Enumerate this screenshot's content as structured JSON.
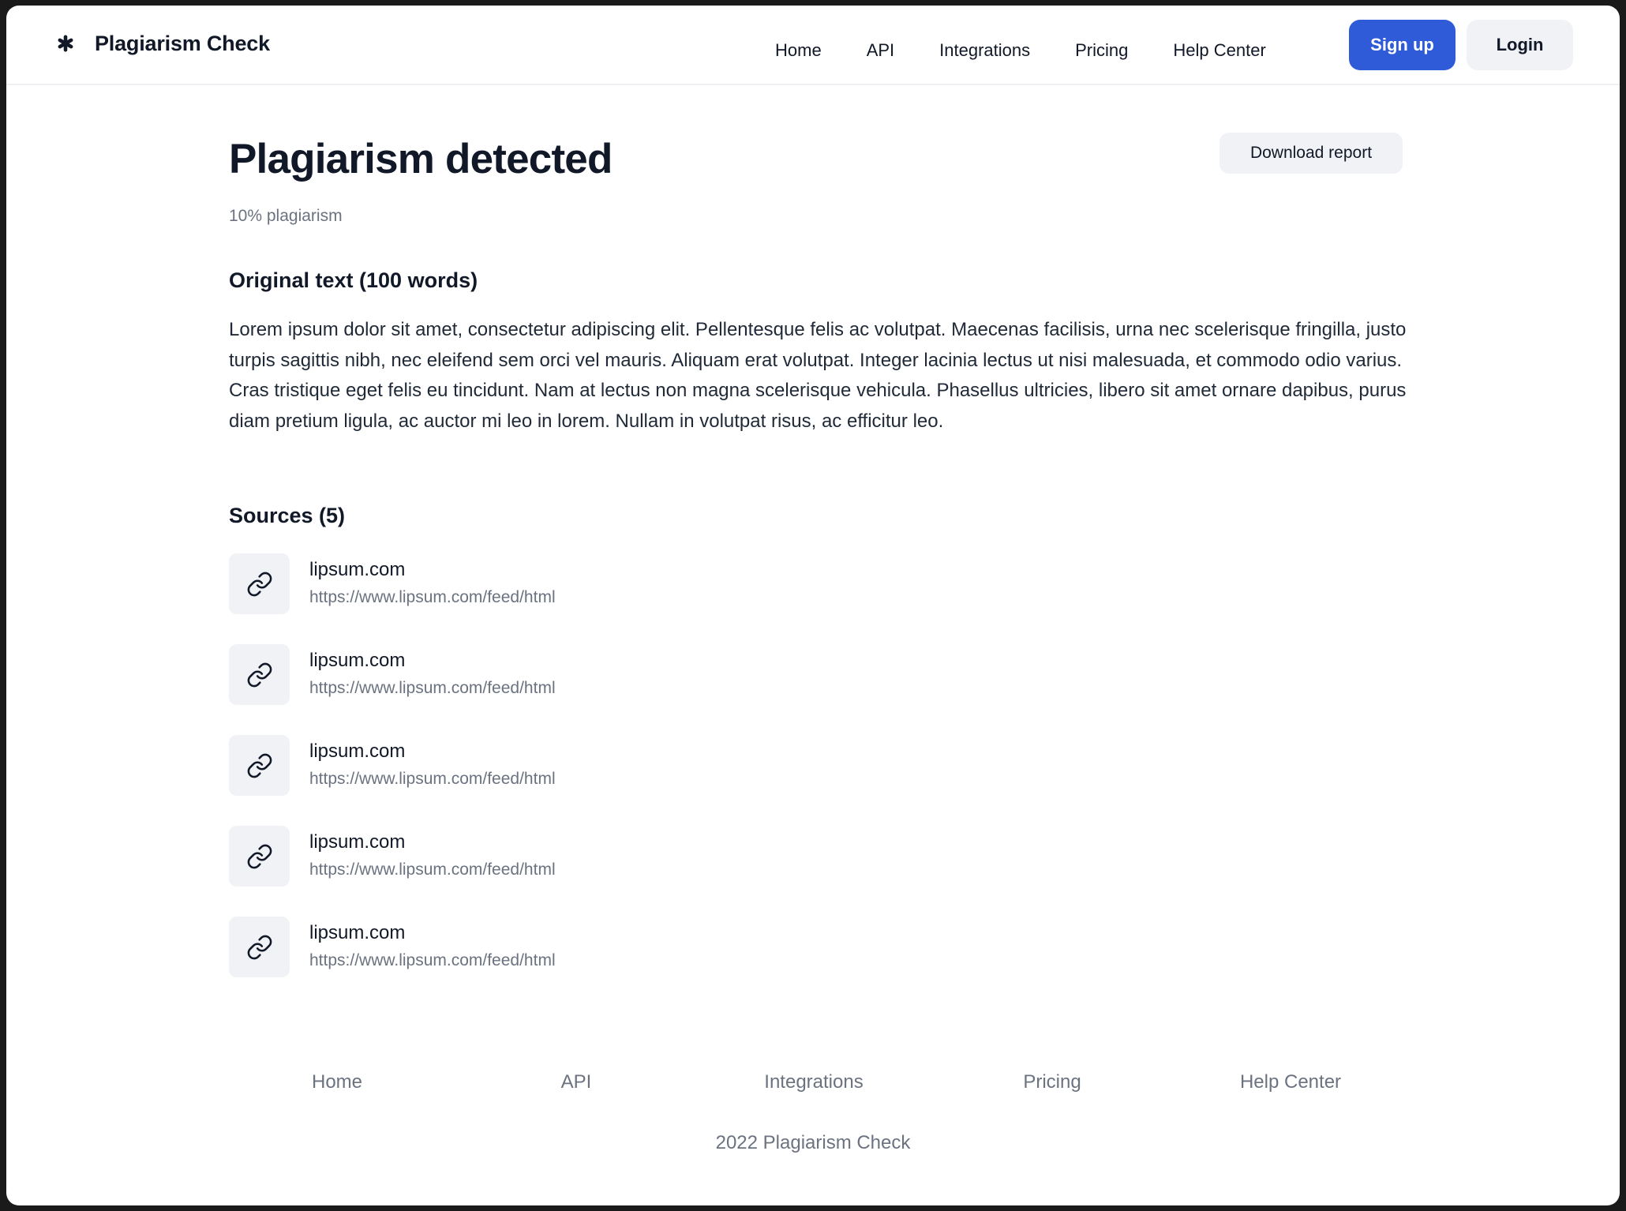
{
  "header": {
    "brand": "Plagiarism Check",
    "brand_icon": "asterisk-icon",
    "nav": [
      "Home",
      "API",
      "Integrations",
      "Pricing",
      "Help Center"
    ],
    "signup_label": "Sign up",
    "login_label": "Login",
    "accent_color": "#2f5bd9"
  },
  "main": {
    "title": "Plagiarism detected",
    "percent_label": "10% plagiarism",
    "download_label": "Download report",
    "original_heading": "Original text (100 words)",
    "original_text": "Lorem ipsum dolor sit amet, consectetur adipiscing elit. Pellentesque felis ac volutpat. Maecenas facilisis, urna nec scelerisque fringilla, justo turpis sagittis nibh, nec eleifend sem orci vel mauris. Aliquam erat volutpat. Integer lacinia lectus ut nisi malesuada, et commodo odio varius. Cras tristique eget felis eu tincidunt. Nam at lectus non magna scelerisque vehicula. Phasellus ultricies, libero sit amet ornare dapibus, purus diam pretium ligula, ac auctor mi leo in lorem. Nullam in volutpat risus, ac efficitur leo.",
    "sources_heading": "Sources (5)",
    "sources": [
      {
        "name": "lipsum.com",
        "url": "https://www.lipsum.com/feed/html",
        "icon": "link-icon"
      },
      {
        "name": "lipsum.com",
        "url": "https://www.lipsum.com/feed/html",
        "icon": "link-icon"
      },
      {
        "name": "lipsum.com",
        "url": "https://www.lipsum.com/feed/html",
        "icon": "link-icon"
      },
      {
        "name": "lipsum.com",
        "url": "https://www.lipsum.com/feed/html",
        "icon": "link-icon"
      },
      {
        "name": "lipsum.com",
        "url": "https://www.lipsum.com/feed/html",
        "icon": "link-icon"
      }
    ]
  },
  "footer": {
    "links": [
      "Home",
      "API",
      "Integrations",
      "Pricing",
      "Help Center"
    ],
    "copyright": "2022 Plagiarism Check"
  }
}
